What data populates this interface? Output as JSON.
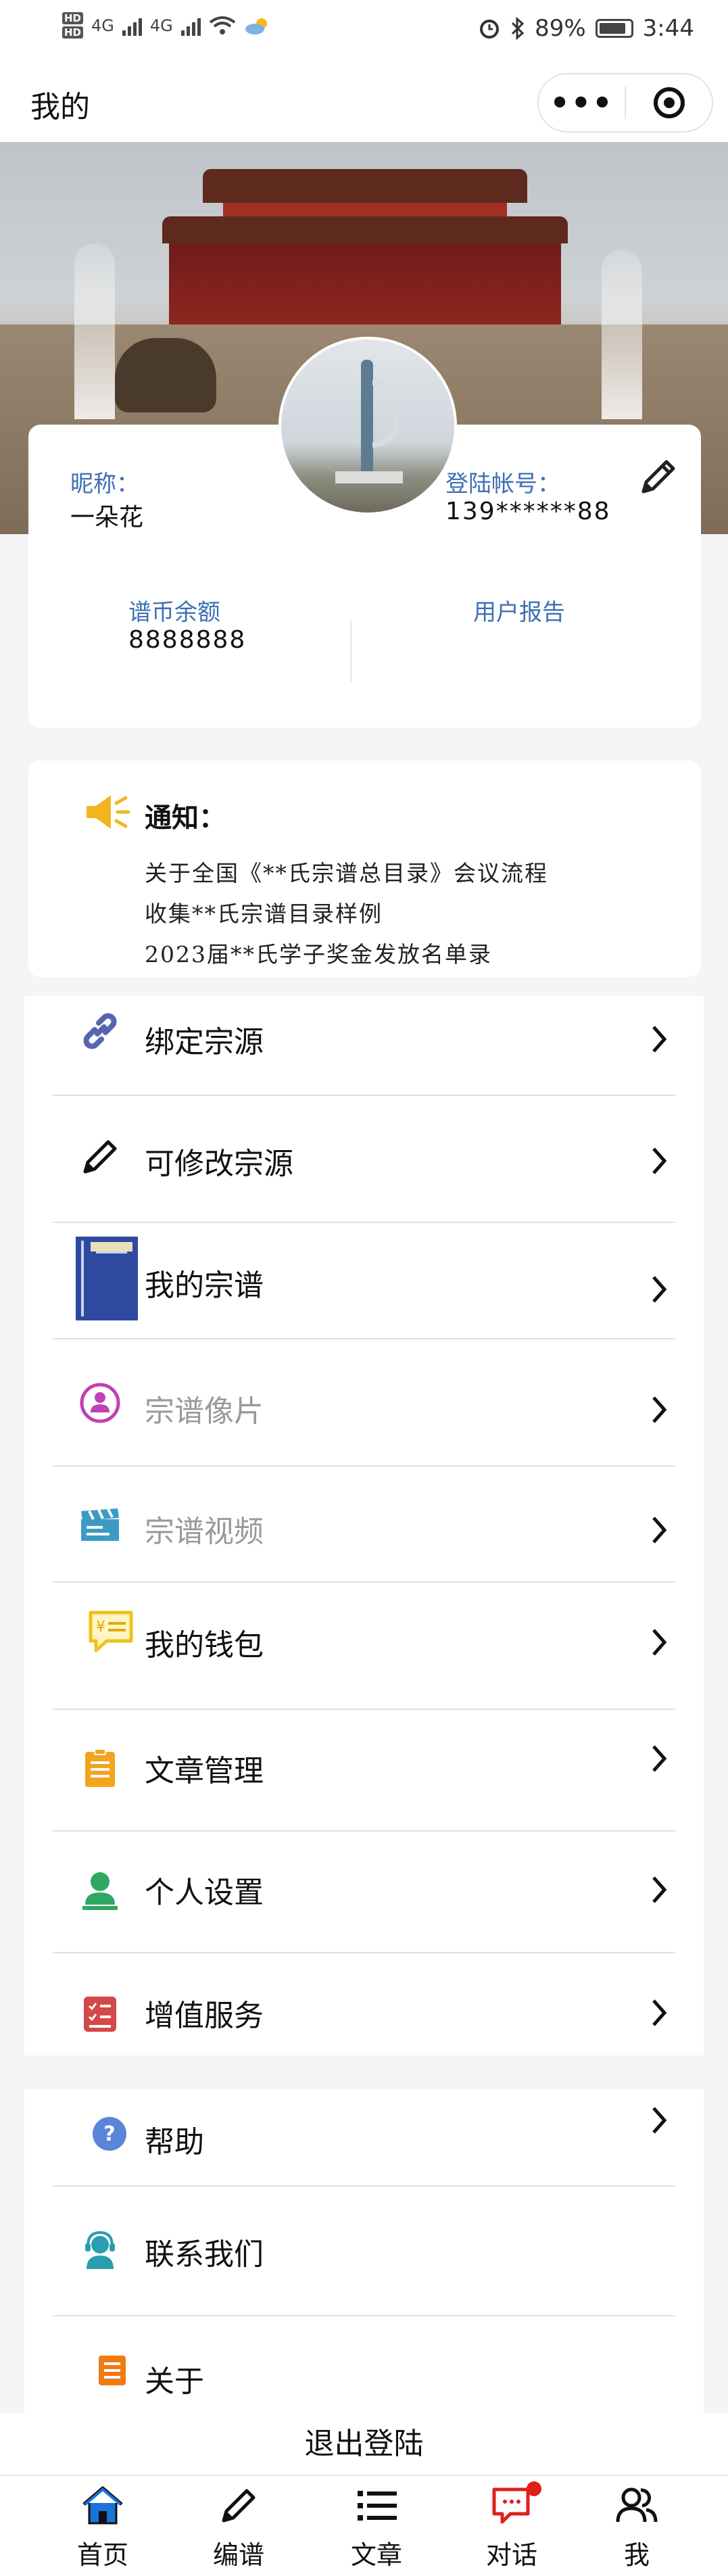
{
  "status_bar": {
    "hd1": "HD",
    "hd2": "HD",
    "net1": "4G",
    "net2": "4G",
    "battery_percent": "89%",
    "time": "3:44",
    "icons": [
      "signal-icon",
      "wifi-icon",
      "weather-icon",
      "alarm-icon",
      "bluetooth-icon",
      "battery-icon"
    ]
  },
  "header": {
    "title": "我的"
  },
  "profile": {
    "nickname_label": "昵称：",
    "nickname": "一朵花",
    "account_label": "登陆帐号：",
    "account": "139******88",
    "balance_label": "谱币余额",
    "balance": "8888888",
    "report_label": "用户报告"
  },
  "notice": {
    "title": "通知：",
    "items": [
      "关于全国《**氏宗谱总目录》会议流程",
      "收集**氏宗谱目录样例",
      "2023届**氏学子奖金发放名单录"
    ]
  },
  "menu_main": [
    {
      "label": "绑定宗源",
      "icon": "link-icon",
      "enabled": true
    },
    {
      "label": "可修改宗源",
      "icon": "pencil-icon",
      "enabled": true
    },
    {
      "label": "我的宗谱",
      "icon": "book-icon",
      "enabled": true
    },
    {
      "label": "宗谱像片",
      "icon": "person-photo-icon",
      "enabled": false
    },
    {
      "label": "宗谱视频",
      "icon": "clapperboard-icon",
      "enabled": false
    },
    {
      "label": "我的钱包",
      "icon": "wallet-icon",
      "enabled": true
    },
    {
      "label": "文章管理",
      "icon": "clipboard-icon",
      "enabled": true
    },
    {
      "label": "个人设置",
      "icon": "user-icon",
      "enabled": true
    },
    {
      "label": "增值服务",
      "icon": "checklist-icon",
      "enabled": true
    }
  ],
  "menu_secondary": [
    {
      "label": "帮助",
      "icon": "help-icon"
    },
    {
      "label": "联系我们",
      "icon": "headset-icon"
    },
    {
      "label": "关于",
      "icon": "about-icon"
    }
  ],
  "logout_label": "退出登陆",
  "tabbar": [
    {
      "label": "首页",
      "icon": "home-icon"
    },
    {
      "label": "编谱",
      "icon": "edit-icon"
    },
    {
      "label": "文章",
      "icon": "list-icon"
    },
    {
      "label": "对话",
      "icon": "chat-icon"
    },
    {
      "label": "我",
      "icon": "users-icon"
    }
  ],
  "colors": {
    "accent_blue": "#3f6fb5",
    "notice_yellow": "#f2b51f",
    "badge_red": "#e0201b"
  }
}
